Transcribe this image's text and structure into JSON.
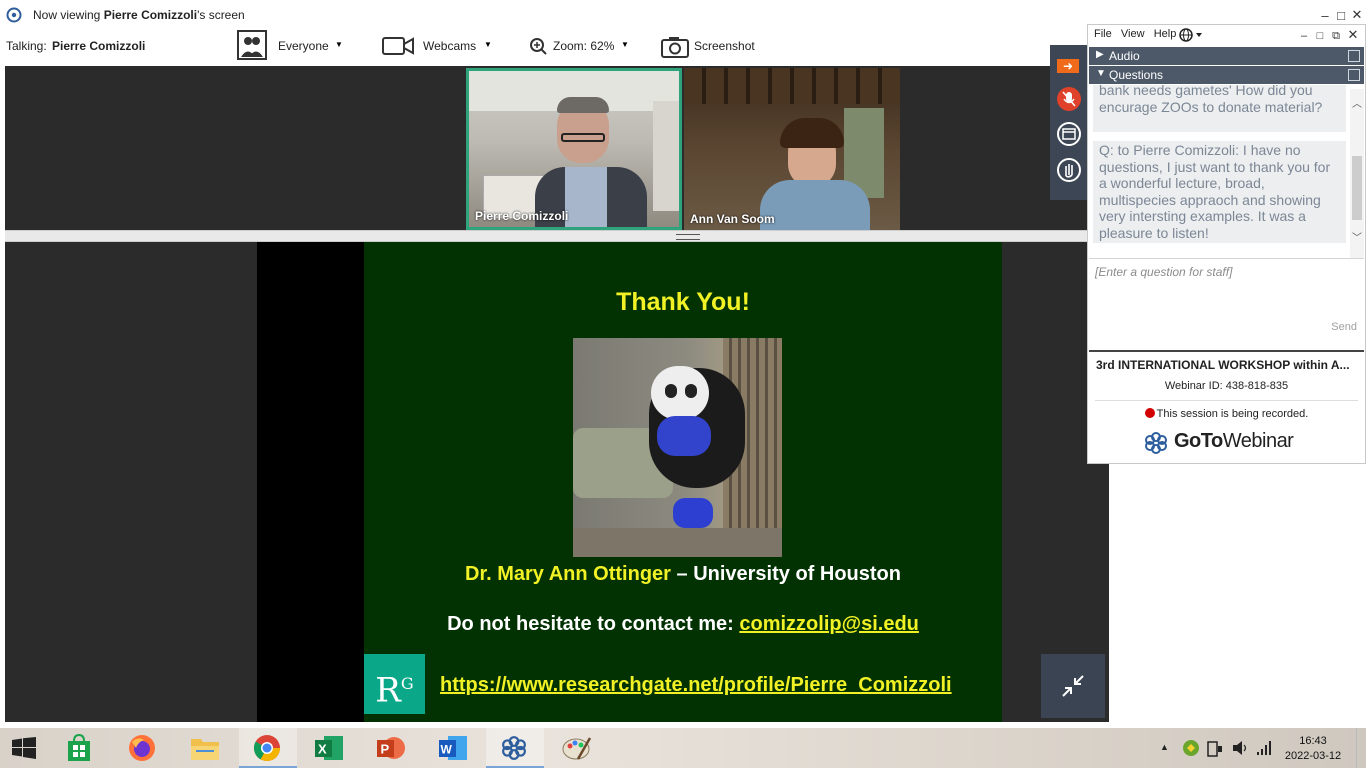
{
  "titlebar": {
    "prefix": "Now viewing ",
    "presenter": "Pierre Comizzoli",
    "suffix": "'s screen"
  },
  "toolbar": {
    "talking_label": "Talking:",
    "talking_name": "Pierre Comizzoli",
    "audience": "Everyone",
    "webcams": "Webcams",
    "zoom": "Zoom: 62%",
    "screenshot": "Screenshot"
  },
  "webcams": [
    {
      "name": "Pierre Comizzoli"
    },
    {
      "name": "Ann Van Soom"
    }
  ],
  "slide": {
    "title": "Thank You!",
    "author_name": "Dr. Mary Ann Ottinger",
    "author_affil": " – University of Houston",
    "contact_label": "Do not hesitate to contact me: ",
    "contact_email": "comizzolip@si.edu",
    "rg_badge": "R",
    "rg_badge_sup": "G",
    "rg_url": "https://www.researchgate.net/profile/Pierre_Comizzoli"
  },
  "panel": {
    "menu": [
      "File",
      "View",
      "Help"
    ],
    "sections": {
      "audio": "Audio",
      "questions": "Questions"
    },
    "questions": [
      "bank needs gametes' How did you encurage ZOOs to donate material?",
      "Q: to Pierre Comizzoli: I have no questions, I just want to thank you for a wonderful lecture, broad, multispecies appraoch and showing very intersting examples. It was a pleasure to listen!"
    ],
    "question_placeholder": "[Enter a question for staff]",
    "send": "Send",
    "webinar_title": "3rd INTERNATIONAL WORKSHOP  within A...",
    "webinar_id": "Webinar ID: 438-818-835",
    "recording": "This session is being recorded.",
    "brand_goto": "GoTo",
    "brand_webinar": "Webinar"
  },
  "taskbar": {
    "apps": [
      "start",
      "store",
      "firefox",
      "file-explorer",
      "chrome",
      "excel",
      "powerpoint",
      "word",
      "gotowebinar",
      "paint"
    ],
    "time": "16:43",
    "date": "2022-03-12"
  },
  "colors": {
    "slide_bg": "#023202",
    "slide_accent": "#f1f125",
    "panel_header": "#4d5968",
    "active_cam_border": "#2fa37c"
  }
}
